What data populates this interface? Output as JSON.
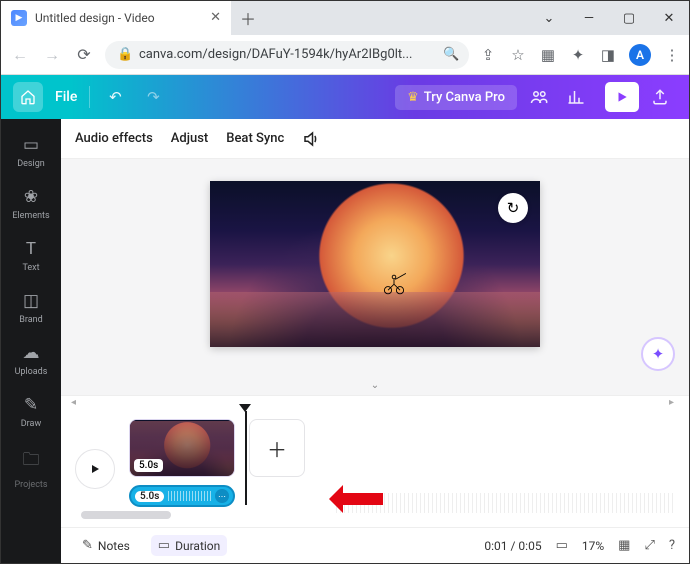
{
  "tab": {
    "title": "Untitled design - Video"
  },
  "url": "canva.com/design/DAFuY-1594k/hyAr2IBg0lt...",
  "avatar_letter": "A",
  "top": {
    "file": "File",
    "try_pro": "Try Canva Pro"
  },
  "rail": {
    "design": "Design",
    "elements": "Elements",
    "text": "Text",
    "brand": "Brand",
    "uploads": "Uploads",
    "draw": "Draw",
    "projects": "Projects"
  },
  "subtoolbar": {
    "audio_effects": "Audio effects",
    "adjust": "Adjust",
    "beat_sync": "Beat Sync"
  },
  "timeline": {
    "clip_duration": "5.0s",
    "audio_duration": "5.0s"
  },
  "bottom": {
    "notes": "Notes",
    "duration": "Duration",
    "time": "0:01 / 0:05",
    "zoom": "17%"
  }
}
